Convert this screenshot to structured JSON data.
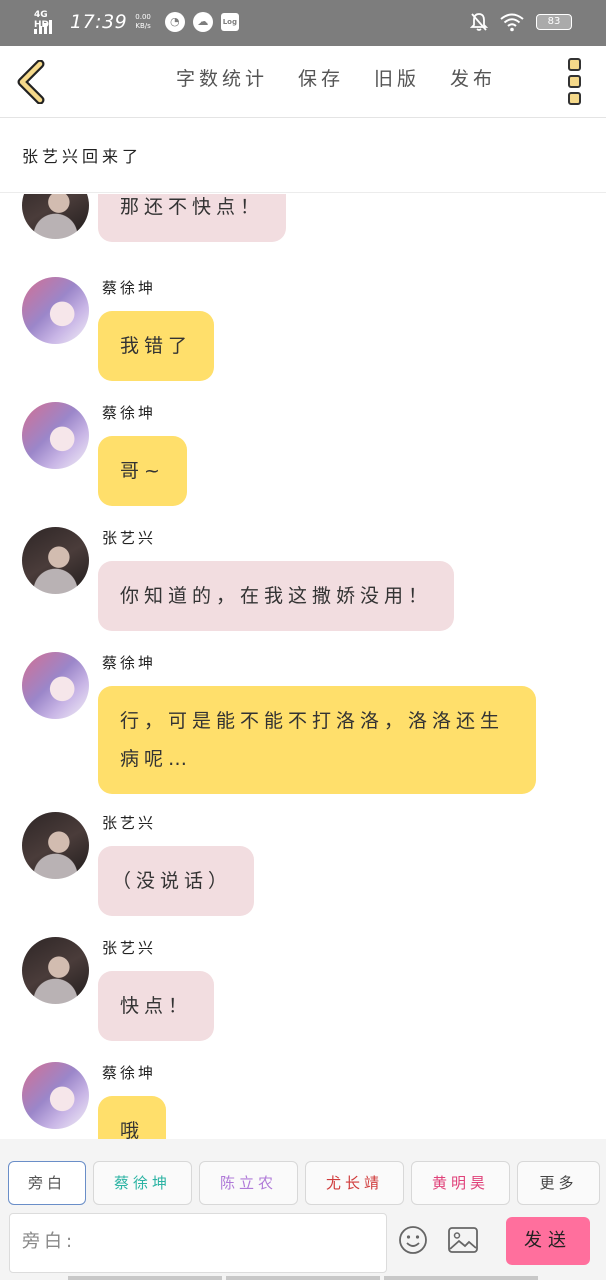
{
  "status_bar": {
    "network": "4G HD",
    "time": "17:39",
    "speed_value": "0.00",
    "speed_unit": "KB/s",
    "log_label": "Log",
    "battery": "83"
  },
  "toolbar": {
    "word_count": "字数统计",
    "save": "保存",
    "old_version": "旧版",
    "publish": "发布"
  },
  "story": {
    "title": "张艺兴回来了"
  },
  "messages": [
    {
      "sender": "",
      "avatar": "zhang",
      "text": "那还不快点！",
      "color": "pink"
    },
    {
      "sender": "蔡徐坤",
      "avatar": "cai",
      "text": "我错了",
      "color": "yellow"
    },
    {
      "sender": "蔡徐坤",
      "avatar": "cai",
      "text": "哥~",
      "color": "yellow"
    },
    {
      "sender": "张艺兴",
      "avatar": "zhang",
      "text": "你知道的，在我这撒娇没用！",
      "color": "pink"
    },
    {
      "sender": "蔡徐坤",
      "avatar": "cai",
      "text": "行，可是能不能不打洛洛，洛洛还生病呢…",
      "color": "yellow"
    },
    {
      "sender": "张艺兴",
      "avatar": "zhang",
      "text": "（没说话）",
      "color": "pink"
    },
    {
      "sender": "张艺兴",
      "avatar": "zhang",
      "text": "快点！",
      "color": "pink"
    },
    {
      "sender": "蔡徐坤",
      "avatar": "cai",
      "text": "哦",
      "color": "yellow"
    }
  ],
  "roles": [
    {
      "label": "旁白",
      "color": "#555555"
    },
    {
      "label": "蔡徐坤",
      "color": "#2bb3a3"
    },
    {
      "label": "陈立农",
      "color": "#b07ad8"
    },
    {
      "label": "尤长靖",
      "color": "#d03b3b"
    },
    {
      "label": "黄明昊",
      "color": "#e0427a"
    },
    {
      "label": "更多",
      "color": "#444444"
    }
  ],
  "composer": {
    "placeholder": "旁白:",
    "send": "发送"
  },
  "colors": {
    "bubble_pink": "#f2dde0",
    "bubble_yellow": "#ffdf6b",
    "send_button": "#ff6f9d",
    "back_arrow": "#f5d98a"
  },
  "icons": [
    "back-arrow-icon",
    "menu-icon",
    "emoji-icon",
    "image-icon",
    "bell-off-icon",
    "wifi-icon",
    "battery-icon"
  ]
}
